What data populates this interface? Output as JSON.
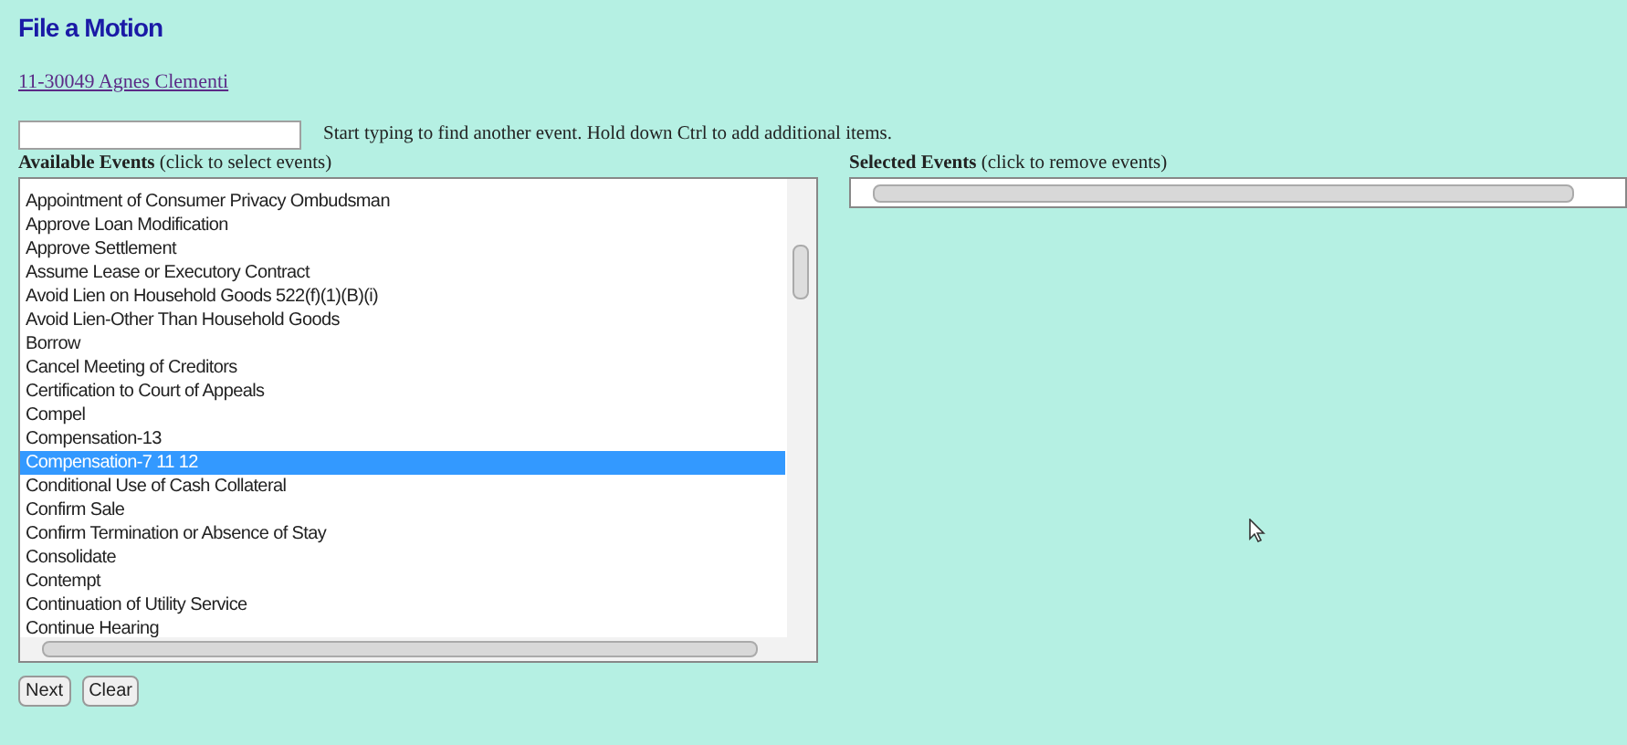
{
  "title": "File a Motion",
  "case_link": "11-30049 Agnes Clementi",
  "search": {
    "hint": "Start typing to find another event. Hold down Ctrl to add additional items."
  },
  "available": {
    "heading": "Available Events",
    "note": "(click to select events)",
    "items": [
      {
        "label": "Appointment of Consumer Privacy Ombudsman",
        "selected": false
      },
      {
        "label": "Approve Loan Modification",
        "selected": false
      },
      {
        "label": "Approve Settlement",
        "selected": false
      },
      {
        "label": "Assume Lease or Executory Contract",
        "selected": false
      },
      {
        "label": "Avoid Lien on Household Goods 522(f)(1)(B)(i)",
        "selected": false
      },
      {
        "label": "Avoid Lien-Other Than Household Goods",
        "selected": false
      },
      {
        "label": "Borrow",
        "selected": false
      },
      {
        "label": "Cancel Meeting of Creditors",
        "selected": false
      },
      {
        "label": "Certification to Court of Appeals",
        "selected": false
      },
      {
        "label": "Compel",
        "selected": false
      },
      {
        "label": "Compensation-13",
        "selected": false
      },
      {
        "label": "Compensation-7 11 12",
        "selected": true
      },
      {
        "label": "Conditional Use of Cash Collateral",
        "selected": false
      },
      {
        "label": "Confirm Sale",
        "selected": false
      },
      {
        "label": "Confirm Termination or Absence of Stay",
        "selected": false
      },
      {
        "label": "Consolidate",
        "selected": false
      },
      {
        "label": "Contempt",
        "selected": false
      },
      {
        "label": "Continuation of Utility Service",
        "selected": false
      },
      {
        "label": "Continue Hearing",
        "selected": false
      }
    ]
  },
  "selected_events": {
    "heading": "Selected Events",
    "note": "(click to remove events)"
  },
  "buttons": [
    "Next",
    "Clear"
  ]
}
